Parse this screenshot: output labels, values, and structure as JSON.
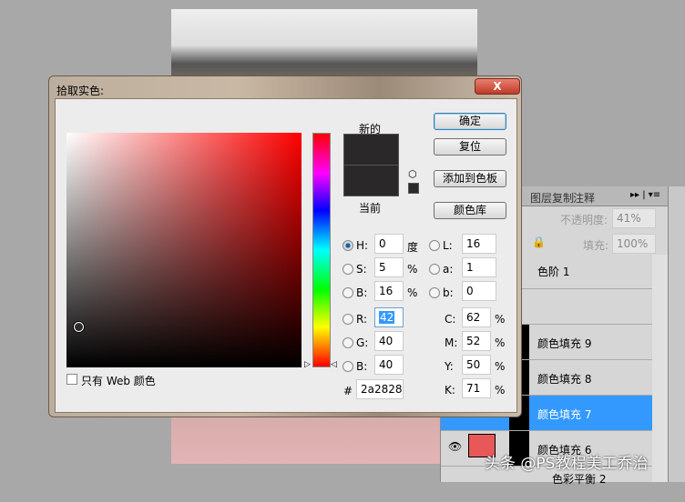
{
  "dialog": {
    "title": "拾取实色:",
    "close": "X",
    "new_label": "新的",
    "current_label": "当前",
    "buttons": {
      "ok": "确定",
      "reset": "复位",
      "add_swatch": "添加到色板",
      "libraries": "颜色库"
    },
    "web_only": "只有 Web 颜色",
    "fields": {
      "H": "0",
      "S": "5",
      "B": "16",
      "R": "42",
      "G": "40",
      "Bv": "40",
      "L": "16",
      "a": "1",
      "b": "0",
      "C": "62",
      "M": "52",
      "Y": "50",
      "K": "71",
      "hex": "2a2828"
    },
    "labels": {
      "H": "H:",
      "S": "S:",
      "B": "B:",
      "R": "R:",
      "G": "G:",
      "Bv": "B:",
      "L": "L:",
      "a": "a:",
      "b": "b:",
      "C": "C:",
      "M": "M:",
      "Y": "Y:",
      "K": "K:",
      "hex": "#",
      "deg": "度",
      "pct": "%"
    },
    "colors": {
      "new": "#2a2828",
      "current": "#2a2828"
    }
  },
  "layers": {
    "tabs": [
      "图层复制",
      "注释"
    ],
    "opacity_label": "不透明度:",
    "opacity": "41%",
    "fill_label": "填充:",
    "fill": "100%",
    "items": [
      "色阶 1",
      "颜色填充 9",
      "颜色填充 8",
      "颜色填充 7",
      "颜色填充 6",
      "色彩平衡 2"
    ],
    "selected": "颜色填充 7"
  },
  "watermark": "头条 @PS教程美工乔治"
}
